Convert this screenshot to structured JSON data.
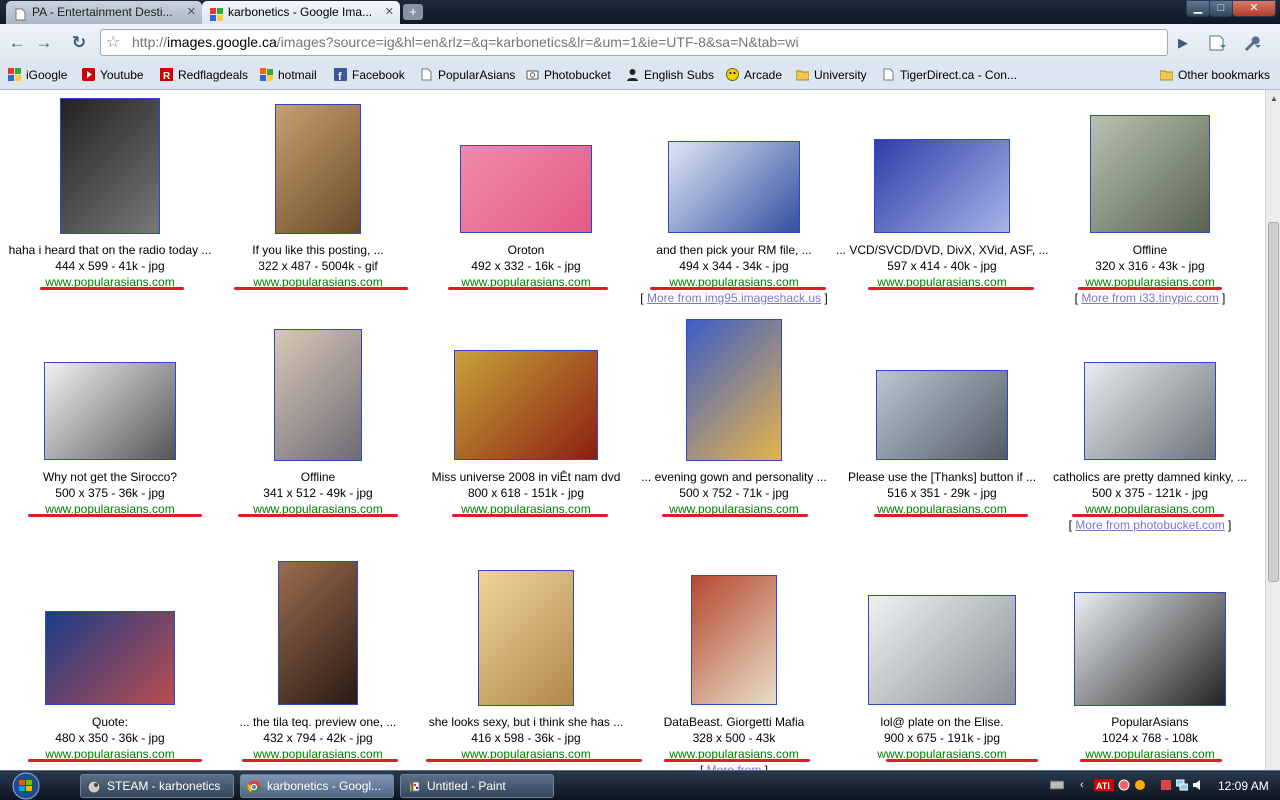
{
  "browser": {
    "tabs": [
      {
        "label": "PA - Entertainment Desti...",
        "active": false
      },
      {
        "label": "karbonetics - Google Ima...",
        "active": true
      }
    ],
    "new_tab": "+",
    "back": "←",
    "forward": "→",
    "reload": "↻",
    "url_prefix": "http://",
    "url_host": "images.google.ca",
    "url_rest": "/images?source=ig&hl=en&rlz=&q=karbonetics&lr=&um=1&ie=UTF-8&sa=N&tab=wi",
    "go": "▶",
    "window_controls": {
      "minimize": "▁",
      "maximize": "□",
      "close": "✕"
    }
  },
  "bookmarks": [
    {
      "label": "iGoogle"
    },
    {
      "label": "Youtube"
    },
    {
      "label": "Redflagdeals"
    },
    {
      "label": "hotmail"
    },
    {
      "label": "Facebook"
    },
    {
      "label": "PopularAsians"
    },
    {
      "label": "Photobucket"
    },
    {
      "label": "English Subs"
    },
    {
      "label": "Arcade"
    },
    {
      "label": "University"
    },
    {
      "label": "TigerDirect.ca - Con..."
    }
  ],
  "other_bookmarks": "Other bookmarks",
  "results": [
    {
      "title": "haha i heard that on the radio today ...",
      "dims": "444 x 599 - 41k - jpg",
      "site": "www.popularasians.com",
      "more": ""
    },
    {
      "title": "If you like this posting, ...",
      "dims": "322 x 487 - 5004k - gif",
      "site": "www.popularasians.com",
      "more": ""
    },
    {
      "title": "Oroton",
      "dims": "492 x 332 - 16k - jpg",
      "site": "www.popularasians.com",
      "more": ""
    },
    {
      "title": "and then pick your RM file, ...",
      "dims": "494 x 344 - 34k - jpg",
      "site": "www.popularasians.com",
      "more": "More from img95.imageshack.us"
    },
    {
      "title": "... VCD/SVCD/DVD, DivX, XVid, ASF, ...",
      "dims": "597 x 414 - 40k - jpg",
      "site": "www.popularasians.com",
      "more": ""
    },
    {
      "title": "Offline",
      "dims": "320 x 316 - 43k - jpg",
      "site": "www.popularasians.com",
      "more": "More from i33.tinypic.com"
    },
    {
      "title": "Why not get the Sirocco?",
      "dims": "500 x 375 - 36k - jpg",
      "site": "www.popularasians.com",
      "more": ""
    },
    {
      "title": "Offline",
      "dims": "341 x 512 - 49k - jpg",
      "site": "www.popularasians.com",
      "more": ""
    },
    {
      "title": "Miss universe 2008 in viÊt nam dvd",
      "dims": "800 x 618 - 151k - jpg",
      "site": "www.popularasians.com",
      "more": ""
    },
    {
      "title": "... evening gown and personality ...",
      "dims": "500 x 752 - 71k - jpg",
      "site": "www.popularasians.com",
      "more": ""
    },
    {
      "title": "Please use the [Thanks] button if ...",
      "dims": "516 x 351 - 29k - jpg",
      "site": "www.popularasians.com",
      "more": ""
    },
    {
      "title": "catholics are pretty damned kinky, ...",
      "dims": "500 x 375 - 121k - jpg",
      "site": "www.popularasians.com",
      "more": "More from photobucket.com"
    },
    {
      "title": "Quote:",
      "dims": "480 x 350 - 36k - jpg",
      "site": "www.popularasians.com",
      "more": ""
    },
    {
      "title": "... the tila teq. preview one, ...",
      "dims": "432 x 794 - 42k - jpg",
      "site": "www.popularasians.com",
      "more": ""
    },
    {
      "title": "she looks sexy, but i think she has ...",
      "dims": "416 x 598 - 36k - jpg",
      "site": "www.popularasians.com",
      "more": ""
    },
    {
      "title": "DataBeast. Giorgetti Mafia",
      "dims": "328 x 500 - 43k",
      "site": "www.popularasians.com",
      "more": "More from"
    },
    {
      "title": "lol@ plate on the Elise.",
      "dims": "900 x 675 - 191k - jpg",
      "site": "www.popularasians.com",
      "more": ""
    },
    {
      "title": "PopularAsians",
      "dims": "1024 x 768 - 108k",
      "site": "www.popularasians.com",
      "more": ""
    }
  ],
  "taskbar": {
    "items": [
      {
        "label": "STEAM - karbonetics"
      },
      {
        "label": "karbonetics - Googl..."
      },
      {
        "label": "Untitled - Paint"
      }
    ],
    "clock": "12:09 AM"
  },
  "colors": {
    "link_green": "#008000",
    "thumb_border": "#2e48c4",
    "redline": "#e11d24"
  }
}
